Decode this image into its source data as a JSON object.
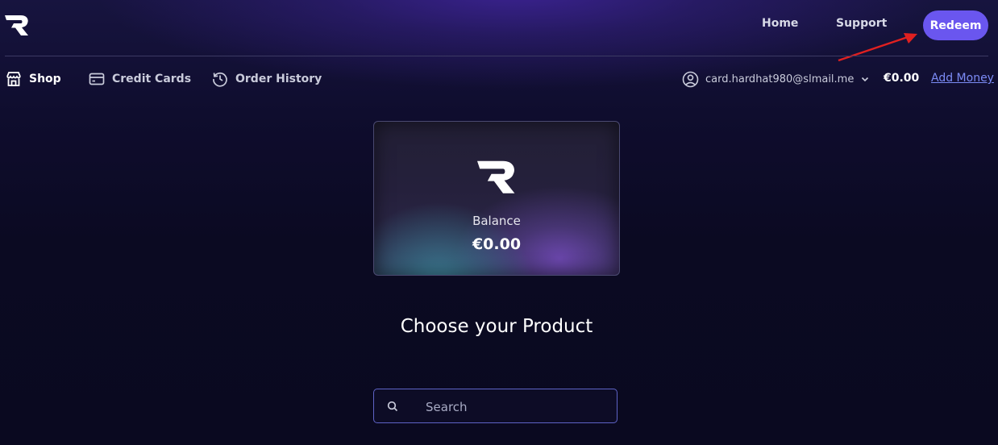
{
  "header": {
    "nav": [
      "Home",
      "Support"
    ],
    "redeem_label": "Redeem",
    "logo_icon": "brand-r-logo",
    "accent": "#6a56ef",
    "annotation_color": "#e02020"
  },
  "subnav": {
    "items": [
      {
        "label": "Shop",
        "icon": "store-icon",
        "active": true
      },
      {
        "label": "Credit Cards",
        "icon": "credit-card-icon",
        "active": false
      },
      {
        "label": "Order History",
        "icon": "history-icon",
        "active": false
      }
    ],
    "account_email": "card.hardhat980@slmail.me",
    "balance": "€0.00",
    "add_money_label": "Add Money"
  },
  "card": {
    "label": "Balance",
    "amount": "€0.00"
  },
  "main": {
    "heading": "Choose your Product",
    "search_placeholder": "Search"
  }
}
